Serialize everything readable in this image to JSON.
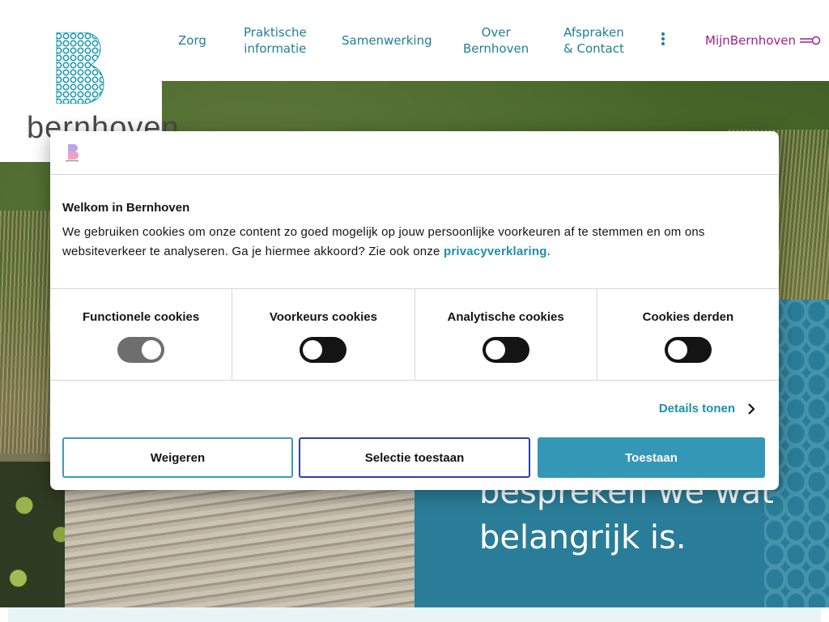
{
  "header": {
    "logo_text": "bernhoven",
    "nav": [
      {
        "line1": "Zorg",
        "line2": ""
      },
      {
        "line1": "Praktische",
        "line2": "informatie"
      },
      {
        "line1": "Samenwerking",
        "line2": ""
      },
      {
        "line1": "Over",
        "line2": "Bernhoven"
      },
      {
        "line1": "Afspraken",
        "line2": "& Contact"
      }
    ],
    "more_icon": "kebab-menu-icon",
    "mijn_label": "MijnBernhoven",
    "key_icon": "key-icon"
  },
  "hero": {
    "text_visible": "bespreken we wat\nbelangrijk is."
  },
  "cookie_dialog": {
    "title": "Welkom in Bernhoven",
    "body_text": "We gebruiken cookies om onze content zo goed mogelijk op jouw persoonlijke voorkeuren af te stemmen en om ons websiteverkeer te analyseren. Ga je hiermee akkoord? Zie ook onze ",
    "link_text": "privacyverklaring",
    "body_end": ".",
    "categories": [
      {
        "label": "Functionele cookies",
        "enabled": true
      },
      {
        "label": "Voorkeurs cookies",
        "enabled": false
      },
      {
        "label": "Analytische cookies",
        "enabled": false
      },
      {
        "label": "Cookies derden",
        "enabled": false
      }
    ],
    "details_label": "Details tonen",
    "buttons": {
      "refuse": "Weigeren",
      "selection": "Selectie toestaan",
      "accept": "Toestaan"
    }
  },
  "colors": {
    "brand_teal": "#1f7f97",
    "brand_purple": "#a0208a",
    "accept_button": "#3597b6",
    "panel_teal": "#2a7d98"
  }
}
